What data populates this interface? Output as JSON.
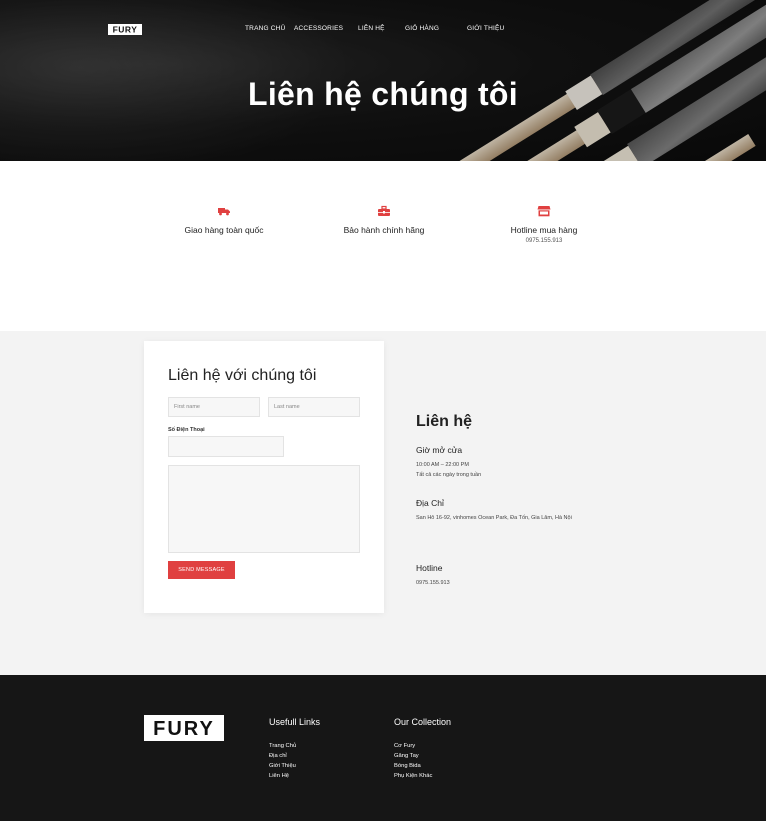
{
  "nav": {
    "logo_text": "FURY",
    "items": [
      "TRANG CHỦ",
      "ACCESSORIES",
      "LIÊN HỆ",
      "GIỎ HÀNG",
      "GIỚI THIỆU"
    ]
  },
  "hero": {
    "title": "Liên hệ chúng tôi"
  },
  "features": [
    {
      "icon": "truck-icon",
      "title": "Giao hàng toàn quốc",
      "subtitle": ""
    },
    {
      "icon": "toolbox-icon",
      "title": "Bảo hành chính hãng",
      "subtitle": ""
    },
    {
      "icon": "store-icon",
      "title": "Hotline mua hàng",
      "subtitle": "0975.155.913"
    }
  ],
  "form": {
    "title": "Liên hệ với chúng tôi",
    "first_name_placeholder": "First name",
    "last_name_placeholder": "Last name",
    "phone_label": "Số Điện Thoại",
    "phone_value": "",
    "message_value": "",
    "send_label": "SEND MESSAGE"
  },
  "info": {
    "title": "Liên hệ",
    "hours_heading": "Giờ mở cửa",
    "hours_line1": "10:00 AM – 22:00 PM",
    "hours_line2": "Tất cả các ngày trong tuần",
    "address_heading": "Địa Chỉ",
    "address_text": "San Hô 16-92, vinhomes Ocean Park, Đa Tốn, Gia Lâm, Hà Nội",
    "hotline_heading": "Hotline",
    "hotline_text": "0975.155.913"
  },
  "footer": {
    "logo_text": "FURY",
    "useful_title": "Usefull Links",
    "useful_links": [
      "Trang Chủ",
      "Địa chỉ",
      "Giới Thiệu",
      "Liên Hệ"
    ],
    "collection_title": "Our Collection",
    "collection_links": [
      "Cơ Fury",
      "Găng Tay",
      "Bóng Bida",
      "Phụ Kiện Khác"
    ]
  },
  "colors": {
    "accent": "#e04040",
    "hero_bg": "#0f0f0f",
    "section_bg": "#f3f3f3",
    "footer_bg": "#161616"
  }
}
